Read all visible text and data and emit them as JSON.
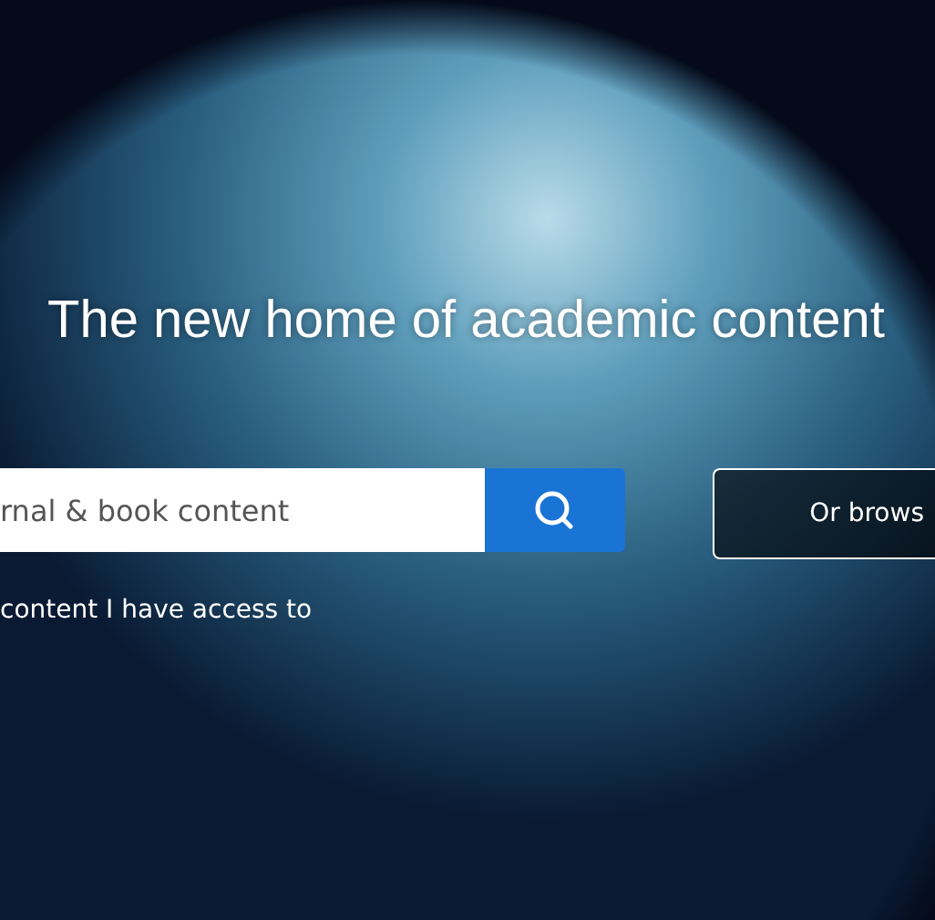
{
  "hero": {
    "title": "The new home of academic content"
  },
  "search": {
    "placeholder": "rnal & book content"
  },
  "browse_button": {
    "label": "Or brows"
  },
  "access_filter": {
    "label": "content I have access to"
  }
}
